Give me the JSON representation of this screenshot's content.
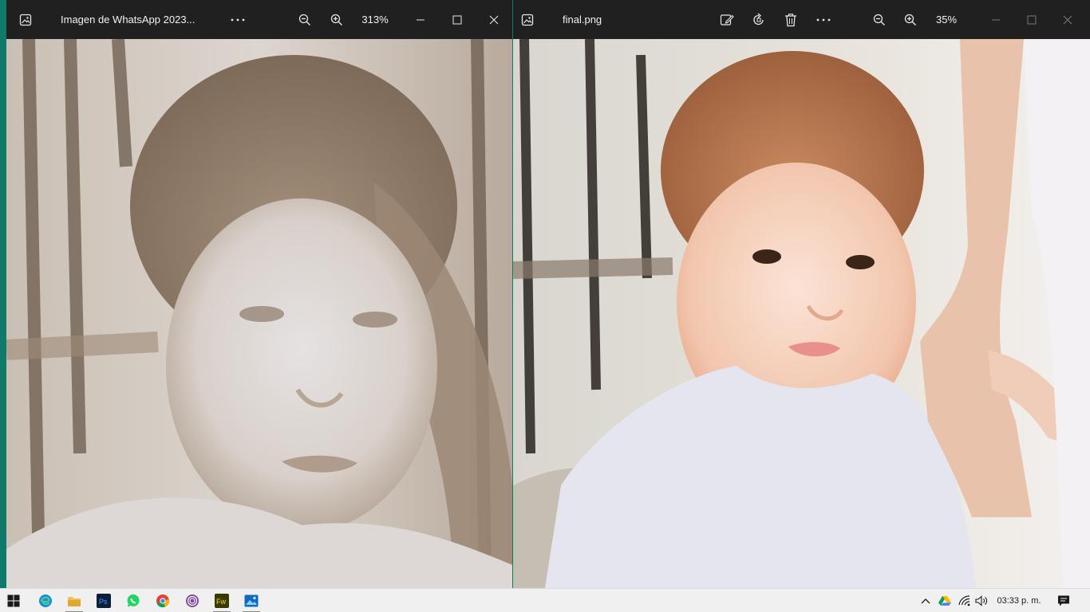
{
  "left_window": {
    "title": "Imagen de WhatsApp 2023...",
    "zoom": "313%",
    "icons": [
      "photos-app-icon",
      "more-icon",
      "zoom-out-icon",
      "zoom-in-icon",
      "minimize-icon",
      "maximize-icon",
      "close-icon"
    ]
  },
  "right_window": {
    "title": "final.png",
    "zoom": "35%",
    "icons": [
      "photos-app-icon",
      "edit-image-icon",
      "rotate-icon",
      "delete-icon",
      "more-icon",
      "zoom-out-icon",
      "zoom-in-icon",
      "minimize-icon",
      "maximize-icon",
      "close-icon"
    ]
  },
  "taskbar": {
    "apps": [
      "windows-start-icon",
      "edge-icon",
      "file-explorer-icon",
      "photoshop-icon",
      "whatsapp-icon",
      "chrome-icon",
      "tor-browser-icon",
      "fireworks-icon",
      "photos-icon"
    ],
    "tray_icons": [
      "show-hidden-icons-chevron",
      "google-drive-icon",
      "wifi-icon",
      "volume-icon",
      "notifications-icon"
    ],
    "clock": "03:33 p. m."
  },
  "colors": {
    "titlebar": "#202020",
    "taskbar": "#f0f0f0",
    "desktop": "#0f7a6a"
  }
}
